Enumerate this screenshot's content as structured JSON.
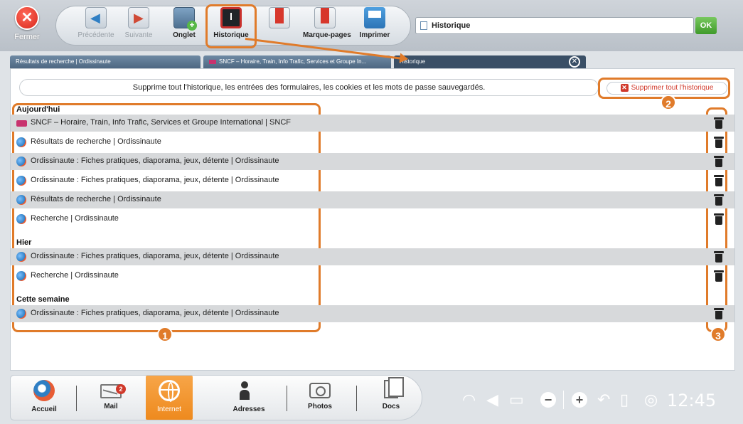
{
  "toolbar": {
    "close_label": "Fermer",
    "prev_label": "Précédente",
    "next_label": "Suivante",
    "tab_label": "Onglet",
    "history_label": "Historique",
    "bookmarks_label": "Marque-pages",
    "print_label": "Imprimer",
    "url_value": "Historique",
    "ok_label": "OK"
  },
  "tabs": [
    {
      "label": "Résultats de recherche | Ordissinaute"
    },
    {
      "label": "SNCF – Horaire, Train, Info Trafic, Services et Groupe In..."
    },
    {
      "label": "Historique"
    }
  ],
  "notice": "Supprime tout l'historique, les entrées des formulaires, les cookies et les mots de passe sauvegardés.",
  "delete_all_label": "Supprimer tout l'historique",
  "sections": {
    "today": "Aujourd'hui",
    "yesterday": "Hier",
    "week": "Cette semaine"
  },
  "history": {
    "today": [
      {
        "title": "SNCF – Horaire, Train, Info Trafic, Services et Groupe International | SNCF",
        "icon": "sncf-icon"
      },
      {
        "title": "Résultats de recherche | Ordissinaute",
        "icon": "ordissinaute-icon"
      },
      {
        "title": "Ordissinaute : Fiches pratiques, diaporama, jeux, détente | Ordissinaute",
        "icon": "ordissinaute-icon"
      },
      {
        "title": "Ordissinaute : Fiches pratiques, diaporama, jeux, détente | Ordissinaute",
        "icon": "ordissinaute-icon"
      },
      {
        "title": "Résultats de recherche | Ordissinaute",
        "icon": "ordissinaute-icon"
      },
      {
        "title": "Recherche | Ordissinaute",
        "icon": "ordissinaute-icon"
      }
    ],
    "yesterday": [
      {
        "title": "Ordissinaute : Fiches pratiques, diaporama, jeux, détente | Ordissinaute",
        "icon": "ordissinaute-icon"
      },
      {
        "title": "Recherche | Ordissinaute",
        "icon": "ordissinaute-icon"
      }
    ],
    "week": [
      {
        "title": "Ordissinaute : Fiches pratiques, diaporama, jeux, détente | Ordissinaute",
        "icon": "ordissinaute-icon"
      }
    ]
  },
  "callouts": [
    "1",
    "2",
    "3"
  ],
  "dock": {
    "home_label": "Accueil",
    "mail_label": "Mail",
    "mail_badge": "2",
    "internet_label": "Internet",
    "addresses_label": "Adresses",
    "photos_label": "Photos",
    "docs_label": "Docs"
  },
  "status": {
    "clock": "12:45"
  },
  "colors": {
    "accent_orange": "#e07b2a",
    "delete_red": "#d0392b",
    "ok_green": "#4fae36",
    "tab_blue": "#4d6782"
  }
}
